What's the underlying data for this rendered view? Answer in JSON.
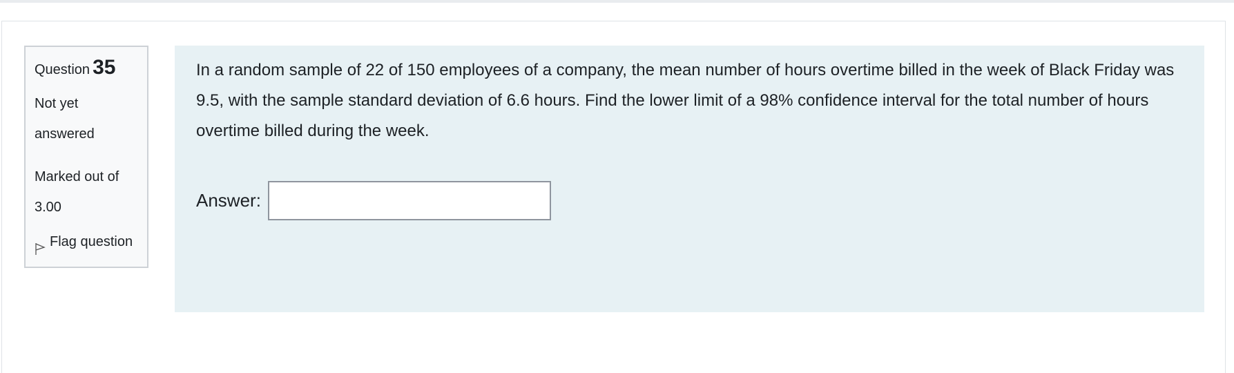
{
  "question": {
    "label": "Question",
    "number": "35",
    "state": "Not yet answered",
    "grade": "Marked out of 3.00",
    "flag_label": "Flag question",
    "flag_icon": "flag-icon",
    "text": "In a random sample of 22 of 150 employees of a company, the mean number of hours overtime billed in the week of Black Friday was 9.5, with the sample standard deviation of 6.6 hours. Find the lower limit of a 98% confidence interval for the total number of hours overtime billed during the week.",
    "answer_label": "Answer:",
    "answer_value": ""
  },
  "colors": {
    "content_background": "#e7f1f4",
    "info_background": "#f8f9fa",
    "info_border": "#cdd1d6"
  }
}
